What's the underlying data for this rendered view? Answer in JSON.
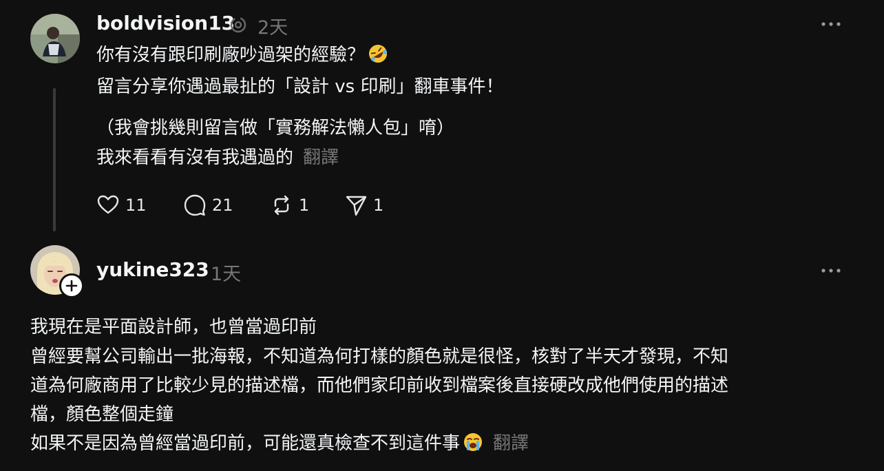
{
  "post": {
    "username": "boldvision13",
    "time": "2天",
    "lines": [
      "你有沒有跟印刷廠吵過架的經驗？",
      "留言分享你遇過最扯的「設計 vs 印刷」翻車事件！",
      "（我會挑幾則留言做「實務解法懶人包」唷）",
      "我來看看有沒有我遇過的"
    ],
    "translate_label": "翻譯",
    "actions": {
      "likes": "11",
      "replies": "21",
      "reposts": "1",
      "shares": "1"
    }
  },
  "reply": {
    "username": "yukine323",
    "time": "1天",
    "lines": [
      "我現在是平面設計師，也曾當過印前",
      "曾經要幫公司輸出一批海報，不知道為何打樣的顏色就是很怪，核對了半天才發現，不知",
      "道為何廠商用了比較少見的描述檔，而他們家印前收到檔案後直接硬改成他們使用的描述",
      "檔，顏色整個走鐘",
      "如果不是因為曾經當過印前，可能還真檢查不到這件事"
    ],
    "translate_label": "翻譯"
  },
  "icons": {
    "more": "more-horizontal-icon",
    "like": "heart-icon",
    "reply": "comment-icon",
    "repost": "repost-icon",
    "share": "send-icon",
    "follow": "plus-icon",
    "emoji1": "rolling-on-floor-laughing-emoji",
    "emoji2": "loudly-crying-face-emoji"
  },
  "colors": {
    "background": "#101010",
    "text": "#f3f5f7",
    "muted": "#777777",
    "thread_line": "#3a3a3a"
  }
}
